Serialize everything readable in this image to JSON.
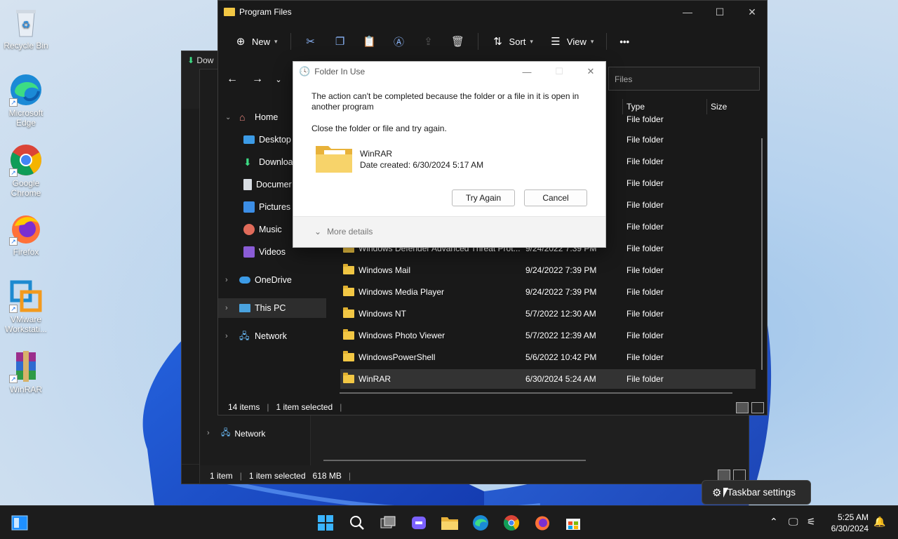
{
  "desktop": {
    "icons": [
      {
        "label": "Recycle Bin"
      },
      {
        "label": "Microsoft Edge"
      },
      {
        "label": "Google Chrome"
      },
      {
        "label": "Firefox"
      },
      {
        "label": "VMware Workstati..."
      },
      {
        "label": "WinRAR"
      }
    ]
  },
  "back_window": {
    "title": "Dow"
  },
  "mid_window": {
    "nav_network": "Network",
    "status": {
      "items": "1 item",
      "selected": "1 item selected",
      "size": "618 MB"
    }
  },
  "explorer": {
    "title": "Program Files",
    "toolbar": {
      "new_label": "New",
      "sort_label": "Sort",
      "view_label": "View",
      "more_label": "•••"
    },
    "search_placeholder": "Files",
    "nav": {
      "home": "Home",
      "desktop": "Desktop",
      "downloads": "Downloa",
      "documents": "Documer",
      "pictures": "Pictures",
      "music": "Music",
      "videos": "Videos",
      "onedrive": "OneDrive",
      "thispc": "This PC",
      "network": "Network"
    },
    "columns": {
      "type": "Type",
      "size": "Size"
    },
    "partial_type_rows": [
      "File folder",
      "File folder",
      "File folder",
      "File folder",
      "File folder",
      "File folder"
    ],
    "rows": [
      {
        "name": "Windows Defender Advanced Threat Prot...",
        "date": "9/24/2022 7:39 PM",
        "type": "File folder"
      },
      {
        "name": "Windows Mail",
        "date": "9/24/2022 7:39 PM",
        "type": "File folder"
      },
      {
        "name": "Windows Media Player",
        "date": "9/24/2022 7:39 PM",
        "type": "File folder"
      },
      {
        "name": "Windows NT",
        "date": "5/7/2022 12:30 AM",
        "type": "File folder"
      },
      {
        "name": "Windows Photo Viewer",
        "date": "5/7/2022 12:39 AM",
        "type": "File folder"
      },
      {
        "name": "WindowsPowerShell",
        "date": "5/6/2022 10:42 PM",
        "type": "File folder"
      },
      {
        "name": "WinRAR",
        "date": "6/30/2024 5:24 AM",
        "type": "File folder"
      }
    ],
    "status": {
      "items": "14 items",
      "selected": "1 item selected"
    }
  },
  "dialog": {
    "title": "Folder In Use",
    "message": "The action can't be completed because the folder or a file in it is open in another program",
    "instruction": "Close the folder or file and try again.",
    "file_name": "WinRAR",
    "file_date": "Date created: 6/30/2024 5:17 AM",
    "try_again": "Try Again",
    "cancel": "Cancel",
    "more_details": "More details"
  },
  "tooltip": {
    "label": "Taskbar settings"
  },
  "taskbar": {
    "time": "5:25 AM",
    "date": "6/30/2024"
  },
  "colors": {
    "accent": "#0078d4",
    "folder": "#f2c744",
    "dark_bg": "#191919"
  }
}
